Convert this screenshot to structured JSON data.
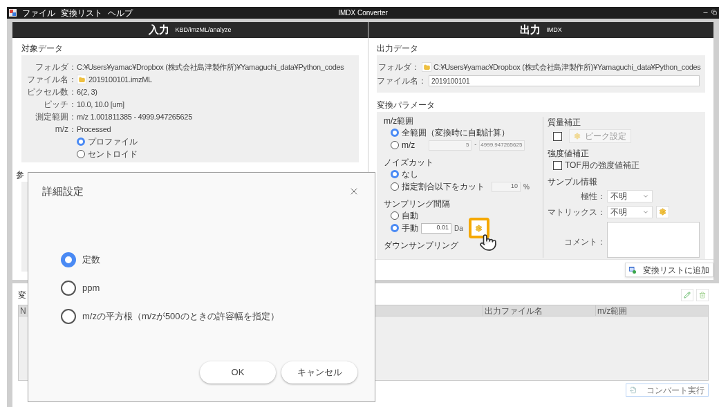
{
  "window": {
    "title": "IMDX Converter",
    "menu": [
      "ファイル",
      "変換リスト",
      "ヘルプ"
    ]
  },
  "input_panel": {
    "title": "入力",
    "subtitle": "KBD/imzML/analyze",
    "section": "対象データ",
    "fields": [
      {
        "kind": "text",
        "label": "フォルダ：",
        "value": "C:¥Users¥yamac¥Dropbox (株式会社島津製作所)¥Yamaguchi_data¥Python_codes"
      },
      {
        "kind": "file",
        "label": "ファイル名：",
        "value": "2019100101.imzML"
      },
      {
        "kind": "text",
        "label": "ピクセル数：",
        "value": "6(2, 3)"
      },
      {
        "kind": "text",
        "label": "ピッチ：",
        "value": "10.0, 10.0 [um]"
      },
      {
        "kind": "text",
        "label": "測定範囲：",
        "value": "m/z 1.001811385 - 4999.947265625"
      },
      {
        "kind": "text",
        "label": "m/z：",
        "value": "Processed"
      }
    ],
    "mz_options": [
      {
        "label": "プロファイル",
        "selected": true
      },
      {
        "label": "セントロイド",
        "selected": false
      }
    ],
    "section_2": "参"
  },
  "output_panel": {
    "title": "出力",
    "subtitle": "IMDX",
    "section": "出力データ",
    "folder": {
      "label": "フォルダ：",
      "value": "C:¥Users¥yamac¥Dropbox (株式会社島津製作所)¥Yamaguchi_data¥Python_codes"
    },
    "filename": {
      "label": "ファイル名：",
      "value": "2019100101"
    },
    "params_title": "変換パラメータ",
    "mz_range": {
      "title": "m/z範囲",
      "options": [
        {
          "label": "全範囲（変換時に自動計算）",
          "selected": true
        },
        {
          "label": "m/z",
          "selected": false
        }
      ],
      "from": "5",
      "separator": "-",
      "to": "4999.947265625"
    },
    "noise_cut": {
      "title": "ノイズカット",
      "options": [
        {
          "label": "なし",
          "selected": true
        },
        {
          "label": "指定割合以下をカット",
          "selected": false
        }
      ],
      "value": "10",
      "unit": "%"
    },
    "sampling": {
      "title": "サンプリング間隔",
      "options": [
        {
          "label": "自動",
          "selected": false
        },
        {
          "label": "手動",
          "selected": true
        }
      ],
      "value": "0.01",
      "unit": "Da",
      "highlighted": true
    },
    "downsampling": {
      "title": "ダウンサンプリング"
    },
    "mass_correction": {
      "title": "質量補正",
      "checked": false,
      "button": "ピーク設定"
    },
    "intensity_correction": {
      "title": "強度値補正",
      "label": "TOF用の強度値補正",
      "checked": false
    },
    "sample_info": {
      "title": "サンプル情報",
      "polarity": {
        "label": "極性：",
        "value": "不明"
      },
      "matrix": {
        "label": "マトリックス：",
        "value": "不明"
      },
      "comment": {
        "label": "コメント："
      }
    },
    "add_button": "変換リストに追加"
  },
  "conversion_list": {
    "section": "変",
    "columns": [
      "N",
      "出力ファイル名",
      "m/z範囲"
    ],
    "convert_button": "コンバート実行"
  },
  "dialog": {
    "title": "詳細設定",
    "options": [
      {
        "label": "定数",
        "selected": true
      },
      {
        "label": "ppm",
        "selected": false
      },
      {
        "label": "m/zの平方根（m/zが500のときの許容幅を指定）",
        "selected": false
      }
    ],
    "ok": "OK",
    "cancel": "キャンセル"
  }
}
